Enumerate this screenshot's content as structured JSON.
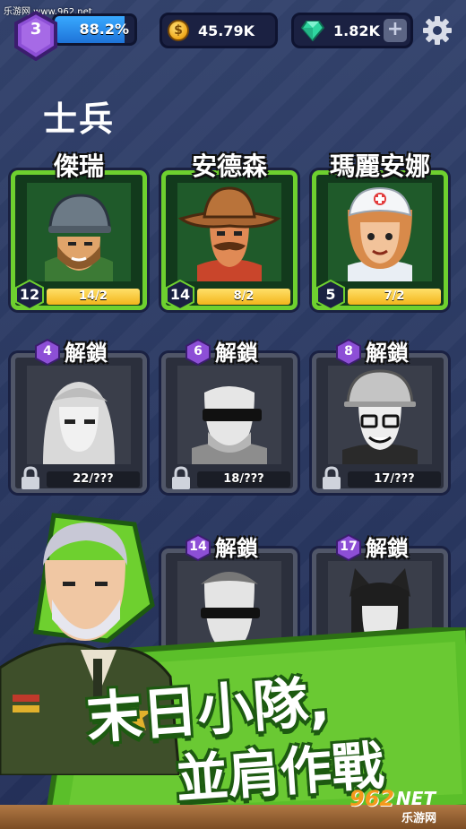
{
  "watermark_top": "乐游网 www.962.net",
  "player": {
    "level": "3",
    "xp_percent_label": "88.2%",
    "xp_fraction": 0.882
  },
  "resources": {
    "coins": "45.79K",
    "gems": "1.82K",
    "coin_symbol": "$",
    "plus": "+"
  },
  "section_title": "士兵",
  "owned_heroes": [
    {
      "name": "傑瑞",
      "level": "12",
      "progress_label": "14/2",
      "progress_fraction": 1.0
    },
    {
      "name": "安德森",
      "level": "14",
      "progress_label": "8/2",
      "progress_fraction": 1.0
    },
    {
      "name": "瑪麗安娜",
      "level": "5",
      "progress_label": "7/2",
      "progress_fraction": 1.0
    }
  ],
  "locked_heroes": [
    {
      "unlock_level": "4",
      "unlock_label": "解鎖",
      "progress_label": "22/???"
    },
    {
      "unlock_level": "6",
      "unlock_label": "解鎖",
      "progress_label": "18/???"
    },
    {
      "unlock_level": "8",
      "unlock_label": "解鎖",
      "progress_label": "17/???"
    },
    {
      "unlock_level": "14",
      "unlock_label": "解鎖",
      "progress_label": ""
    },
    {
      "unlock_level": "17",
      "unlock_label": "解鎖",
      "progress_label": ""
    }
  ],
  "slogan": {
    "line1": "末日小隊,",
    "line2": "並肩作戰"
  },
  "watermark_bottom": {
    "num": "962",
    "net": "NET",
    "cn": "乐游网"
  },
  "colors": {
    "owned_frame": "#6ed02f",
    "locked_frame": "#505668",
    "xp_fill": "#1e73d8",
    "progress_fill": "#f3b51b",
    "badge_purple": "#8d4fd6",
    "banner_green": "#5bbf2a"
  }
}
